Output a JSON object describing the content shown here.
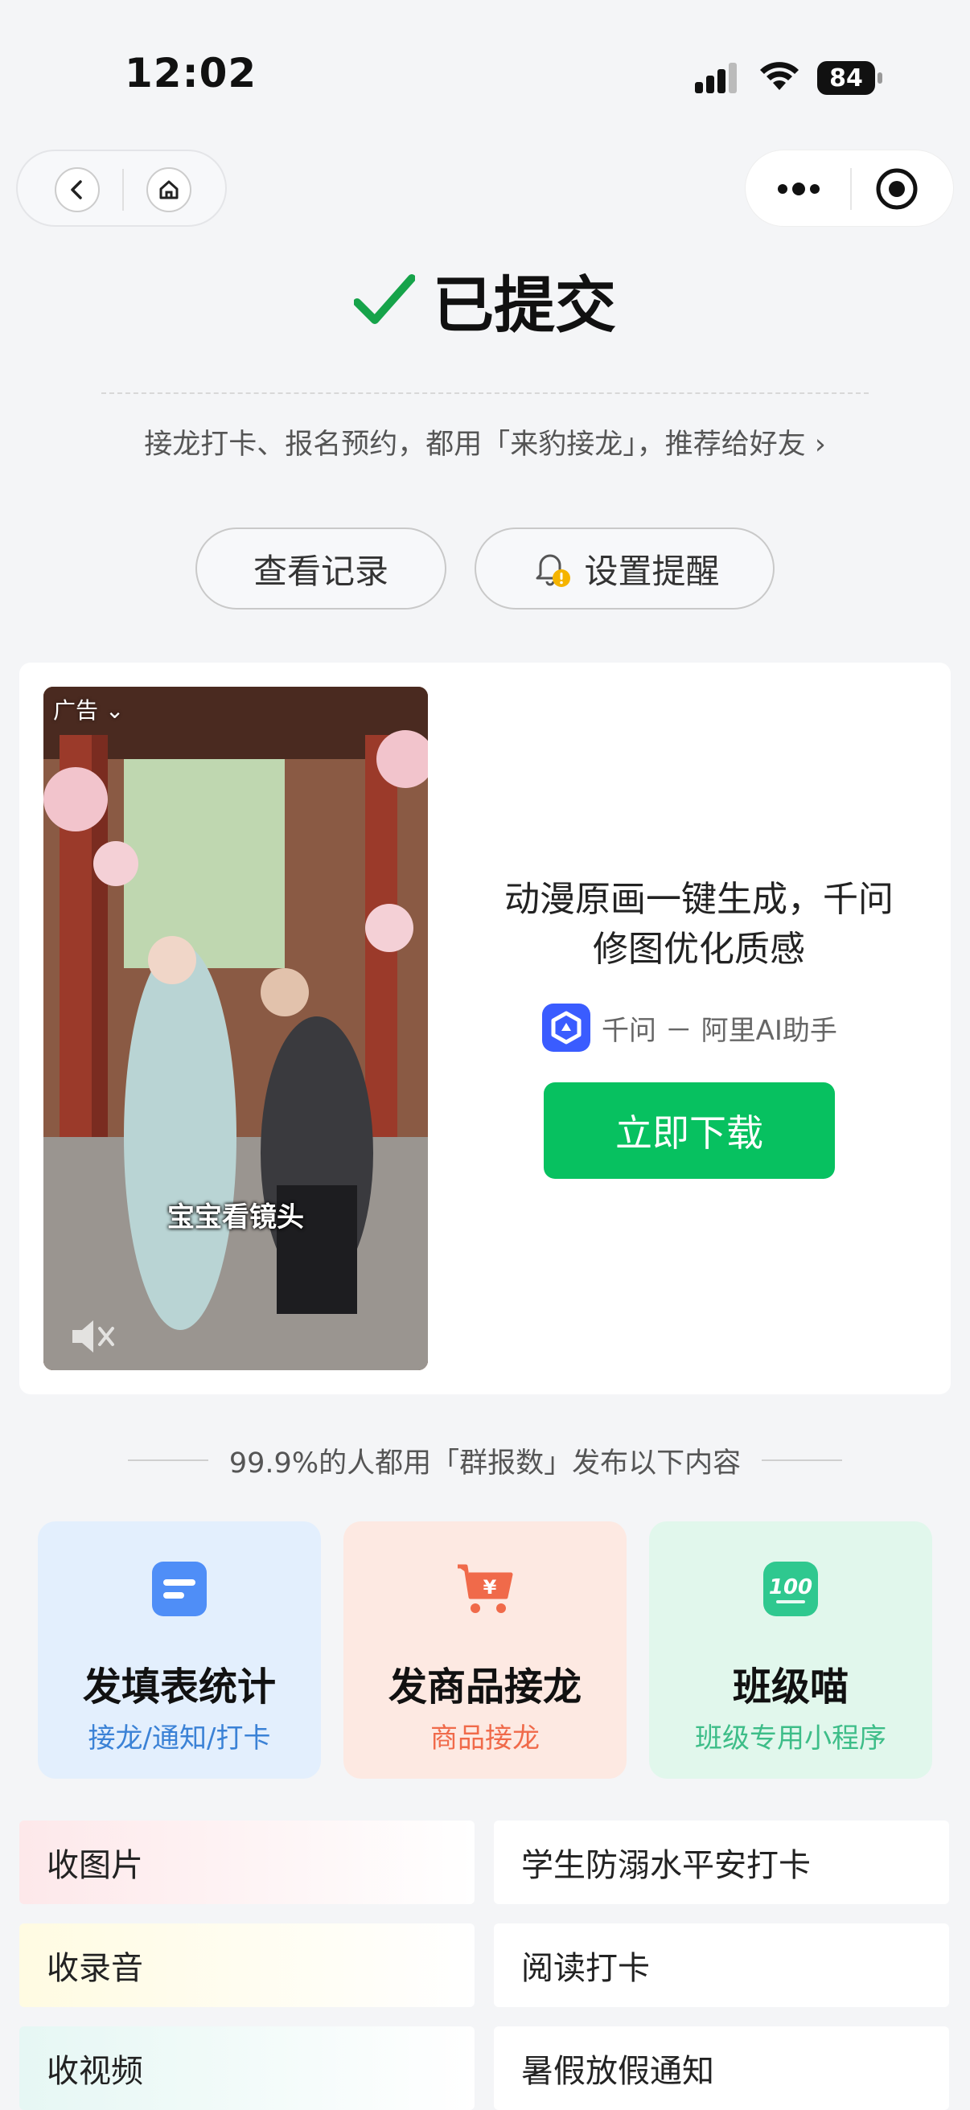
{
  "status_bar": {
    "time": "12:02",
    "battery": "84",
    "icons": [
      "signal-icon",
      "wifi-icon",
      "battery-icon"
    ]
  },
  "nav": {
    "back_icon": "back-chevron-icon",
    "home_icon": "home-icon",
    "more_icon": "more-dots-icon",
    "close_icon": "miniprogram-close-icon"
  },
  "result": {
    "title": "已提交",
    "check_color": "#07c160",
    "recommend_text": "接龙打卡、报名预约，都用「来豹接龙」，推荐给好友 ›"
  },
  "actions": {
    "view_records": "查看记录",
    "set_reminder": "设置提醒",
    "reminder_icon": "bell-warning-icon"
  },
  "ad": {
    "tag": "广告",
    "video_caption": "宝宝看镜头",
    "headline_line1": "动漫原画一键生成，千问",
    "headline_line2": "修图优化质感",
    "brand": "千问 － 阿里AI助手",
    "download_label": "立即下载",
    "download_color": "#07c160",
    "mute_icon": "mute-icon"
  },
  "section": {
    "title": "99.9%的人都用「群报数」发布以下内容"
  },
  "features": [
    {
      "title": "发填表统计",
      "subtitle": "接龙/通知/打卡",
      "icon": "form-doc-icon",
      "subtitle_color": "#3b82d6"
    },
    {
      "title": "发商品接龙",
      "subtitle": "商品接龙",
      "icon": "shopping-cart-icon",
      "subtitle_color": "#f06a4a"
    },
    {
      "title": "班级喵",
      "subtitle": "班级专用小程序",
      "icon": "score-100-icon",
      "subtitle_color": "#3dbd88"
    }
  ],
  "list": {
    "left": [
      "收图片",
      "收录音",
      "收视频"
    ],
    "right": [
      "学生防溺水平安打卡",
      "阅读打卡",
      "暑假放假通知"
    ]
  }
}
